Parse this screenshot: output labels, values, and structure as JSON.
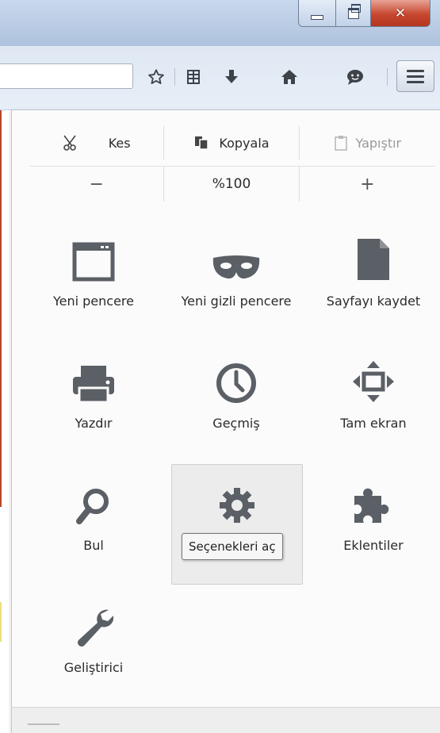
{
  "window": {
    "controls": {
      "minimize_icon": "minimize-icon",
      "maximize_icon": "restore-icon",
      "close_icon": "close-icon"
    }
  },
  "toolbar": {
    "url_value": "",
    "icons": [
      "bookmark-star-icon",
      "reading-list-icon",
      "download-icon",
      "home-icon",
      "chat-icon"
    ],
    "menu_icon": "hamburger-menu-icon"
  },
  "menu": {
    "edit": {
      "cut_label": "Kes",
      "copy_label": "Kopyala",
      "paste_label": "Yapıştır"
    },
    "zoom": {
      "out_label": "−",
      "value": "%100",
      "in_label": "+"
    },
    "items": [
      {
        "label": "Yeni pencere",
        "icon": "window-icon"
      },
      {
        "label": "Yeni gizli pencere",
        "icon": "mask-icon"
      },
      {
        "label": "Sayfayı kaydet",
        "icon": "page-icon"
      },
      {
        "label": "Yazdır",
        "icon": "printer-icon"
      },
      {
        "label": "Geçmiş",
        "icon": "clock-icon"
      },
      {
        "label": "Tam ekran",
        "icon": "fullscreen-icon"
      },
      {
        "label": "Bul",
        "icon": "magnifier-icon"
      },
      {
        "label": "Seçenekler",
        "icon": "gear-icon"
      },
      {
        "label": "Eklentiler",
        "icon": "puzzle-icon"
      },
      {
        "label": "Geliştirici",
        "icon": "wrench-icon"
      }
    ],
    "tooltip": "Seçenekleri aç"
  },
  "colors": {
    "icon": "#5b5f66",
    "close_button": "#c8472f",
    "titlebar": "#b9cbe3"
  }
}
